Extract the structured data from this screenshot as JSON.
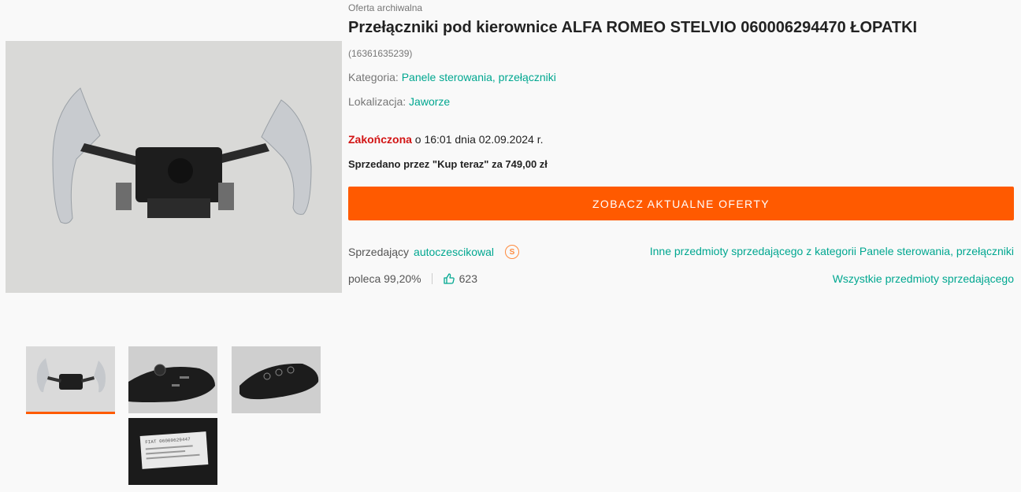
{
  "offer": {
    "archival_label": "Oferta archiwalna",
    "title": "Przełączniki pod kierownice ALFA ROMEO STELVIO 060006294470 ŁOPATKI",
    "id": "(16361635239)",
    "category_label": "Kategoria:",
    "category_value": "Panele sterowania, przełączniki",
    "location_label": "Lokalizacja:",
    "location_value": "Jaworze",
    "ended_status": "Zakończona",
    "ended_details": " o 16:01 dnia 02.09.2024 r.",
    "sold_text": "Sprzedano przez \"Kup teraz\" za 749,00 zł",
    "cta_label": "ZOBACZ AKTUALNE OFERTY"
  },
  "seller": {
    "label": "Sprzedający",
    "name": "autoczescikowal",
    "badge": "S",
    "recommend": "poleca 99,20%",
    "likes": "623",
    "other_items_link": "Inne przedmioty sprzedającego z kategorii Panele sterowania, przełączniki",
    "all_items_link": "Wszystkie przedmioty sprzedającego"
  },
  "colors": {
    "accent": "#ff5a00",
    "link": "#00a790",
    "ended": "#d21414"
  },
  "images": {
    "label_sticker": "FIAT 06000629447"
  }
}
